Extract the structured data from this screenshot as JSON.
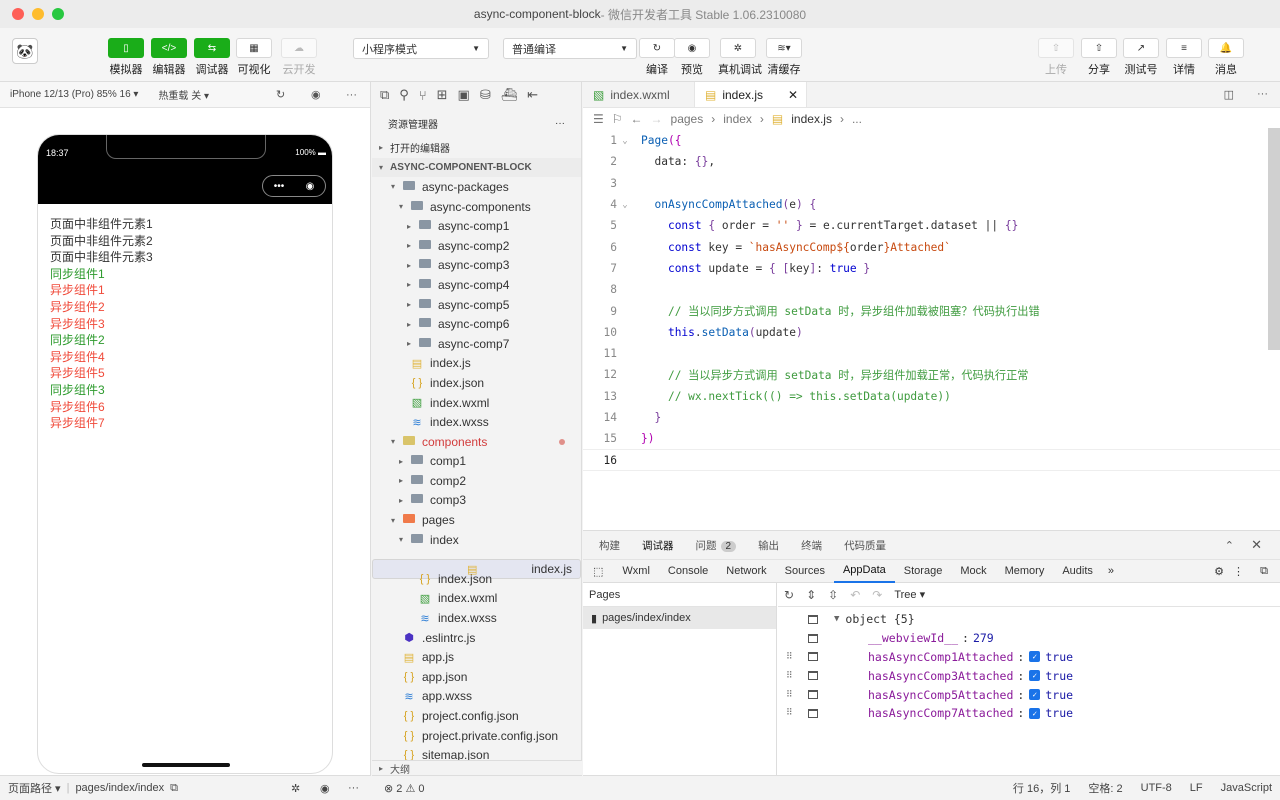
{
  "window": {
    "title": "async-component-block",
    "subtitle": " - 微信开发者工具 Stable 1.06.2310080",
    "lights": [
      "#fe5f57",
      "#febc2e",
      "#28c840"
    ]
  },
  "toolbar": {
    "simulator": "模拟器",
    "editor": "编辑器",
    "debugger": "调试器",
    "visual": "可视化",
    "cloud": "云开发",
    "mode_select": "小程序模式",
    "compile_select": "普通编译",
    "compile": "编译",
    "preview": "预览",
    "remote_debug": "真机调试",
    "clear_cache": "清缓存",
    "upload": "上传",
    "share": "分享",
    "test_account": "测试号",
    "details": "详情",
    "messages": "消息"
  },
  "simulator": {
    "device": "iPhone 12/13 (Pro) 85% 16 ▾",
    "hot_reload": "热重载 关 ▾",
    "time": "18:37",
    "battery": "100%",
    "items": [
      {
        "text": "页面中非组件元素1",
        "color": "#333333"
      },
      {
        "text": "页面中非组件元素2",
        "color": "#333333"
      },
      {
        "text": "页面中非组件元素3",
        "color": "#333333"
      },
      {
        "text": "同步组件1",
        "color": "#2e9b2e"
      },
      {
        "text": "异步组件1",
        "color": "#f04a3a"
      },
      {
        "text": "异步组件2",
        "color": "#f04a3a"
      },
      {
        "text": "异步组件3",
        "color": "#f04a3a"
      },
      {
        "text": "同步组件2",
        "color": "#2e9b2e"
      },
      {
        "text": "异步组件4",
        "color": "#f04a3a"
      },
      {
        "text": "异步组件5",
        "color": "#f04a3a"
      },
      {
        "text": "同步组件3",
        "color": "#2e9b2e"
      },
      {
        "text": "异步组件6",
        "color": "#f04a3a"
      },
      {
        "text": "异步组件7",
        "color": "#f04a3a"
      }
    ],
    "status_path_label": "页面路径 ▾",
    "status_path": "pages/index/index"
  },
  "explorer": {
    "header": "资源管理器",
    "open_editors": "打开的编辑器",
    "project": "ASYNC-COMPONENT-BLOCK",
    "tree": [
      {
        "indent": 16,
        "tw": "▾",
        "icon": "folder",
        "label": "async-packages"
      },
      {
        "indent": 24,
        "tw": "▾",
        "icon": "folder",
        "label": "async-components"
      },
      {
        "indent": 32,
        "tw": "▸",
        "icon": "folder",
        "label": "async-comp1"
      },
      {
        "indent": 32,
        "tw": "▸",
        "icon": "folder",
        "label": "async-comp2"
      },
      {
        "indent": 32,
        "tw": "▸",
        "icon": "folder",
        "label": "async-comp3"
      },
      {
        "indent": 32,
        "tw": "▸",
        "icon": "folder",
        "label": "async-comp4"
      },
      {
        "indent": 32,
        "tw": "▸",
        "icon": "folder",
        "label": "async-comp5"
      },
      {
        "indent": 32,
        "tw": "▸",
        "icon": "folder",
        "label": "async-comp6"
      },
      {
        "indent": 32,
        "tw": "▸",
        "icon": "folder",
        "label": "async-comp7"
      },
      {
        "indent": 24,
        "tw": "",
        "icon": "js",
        "label": "index.js"
      },
      {
        "indent": 24,
        "tw": "",
        "icon": "json",
        "label": "index.json"
      },
      {
        "indent": 24,
        "tw": "",
        "icon": "wxml",
        "label": "index.wxml"
      },
      {
        "indent": 24,
        "tw": "",
        "icon": "wxss",
        "label": "index.wxss"
      },
      {
        "indent": 16,
        "tw": "▾",
        "icon": "folder-y",
        "label": "components",
        "color": "#d23c3c",
        "dot": true
      },
      {
        "indent": 24,
        "tw": "▸",
        "icon": "folder",
        "label": "comp1"
      },
      {
        "indent": 24,
        "tw": "▸",
        "icon": "folder",
        "label": "comp2"
      },
      {
        "indent": 24,
        "tw": "▸",
        "icon": "folder",
        "label": "comp3"
      },
      {
        "indent": 16,
        "tw": "▾",
        "icon": "folder-r",
        "label": "pages"
      },
      {
        "indent": 24,
        "tw": "▾",
        "icon": "folder",
        "label": "index"
      },
      {
        "indent": 32,
        "tw": "",
        "icon": "js",
        "label": "index.js",
        "selected": true
      },
      {
        "indent": 32,
        "tw": "",
        "icon": "json",
        "label": "index.json"
      },
      {
        "indent": 32,
        "tw": "",
        "icon": "wxml",
        "label": "index.wxml"
      },
      {
        "indent": 32,
        "tw": "",
        "icon": "wxss",
        "label": "index.wxss"
      },
      {
        "indent": 16,
        "tw": "",
        "icon": "eslint",
        "label": ".eslintrc.js"
      },
      {
        "indent": 16,
        "tw": "",
        "icon": "js",
        "label": "app.js"
      },
      {
        "indent": 16,
        "tw": "",
        "icon": "json",
        "label": "app.json"
      },
      {
        "indent": 16,
        "tw": "",
        "icon": "wxss",
        "label": "app.wxss"
      },
      {
        "indent": 16,
        "tw": "",
        "icon": "json",
        "label": "project.config.json"
      },
      {
        "indent": 16,
        "tw": "",
        "icon": "json",
        "label": "project.private.config.json"
      },
      {
        "indent": 16,
        "tw": "",
        "icon": "json",
        "label": "sitemap.json"
      }
    ],
    "outline": "大纲",
    "problems": "⊗ 2 ⚠ 0"
  },
  "editor": {
    "tabs": [
      {
        "label": "index.wxml",
        "icon": "wxml",
        "active": false
      },
      {
        "label": "index.js",
        "icon": "js",
        "active": true
      }
    ],
    "breadcrumbs": [
      "pages",
      "index",
      "index.js",
      "..."
    ],
    "lines": [
      {
        "n": "1",
        "fold": "⌄",
        "html": "<span class='f'>Page</span><span class='b'>({</span>"
      },
      {
        "n": "2",
        "fold": "",
        "html": "  data: <span class='p'>{}</span>,"
      },
      {
        "n": "3",
        "fold": "",
        "html": ""
      },
      {
        "n": "4",
        "fold": "⌄",
        "html": "  <span class='f'>onAsyncCompAttached</span><span class='p'>(</span>e<span class='p'>)</span> <span class='p'>{</span>"
      },
      {
        "n": "5",
        "fold": "",
        "html": "    <span class='k'>const</span> <span class='p'>{</span> order = <span class='s'>''</span> <span class='p'>}</span> = e.currentTarget.dataset || <span class='p'>{}</span>"
      },
      {
        "n": "6",
        "fold": "",
        "html": "    <span class='k'>const</span> key = <span class='s'>`hasAsyncComp${</span>order<span class='s'>}Attached`</span>"
      },
      {
        "n": "7",
        "fold": "",
        "html": "    <span class='k'>const</span> update = <span class='p'>{</span> <span class='p'>[</span>key<span class='p'>]</span>: <span class='k'>true</span> <span class='p'>}</span>"
      },
      {
        "n": "8",
        "fold": "",
        "html": ""
      },
      {
        "n": "9",
        "fold": "",
        "html": "    <span class='c'>// 当以同步方式调用 setData 时，异步组件加载被阻塞？代码执行出错</span>"
      },
      {
        "n": "10",
        "fold": "",
        "html": "    <span class='k'>this</span>.<span class='f'>setData</span><span class='p'>(</span>update<span class='p'>)</span>"
      },
      {
        "n": "11",
        "fold": "",
        "html": ""
      },
      {
        "n": "12",
        "fold": "",
        "html": "    <span class='c'>// 当以异步方式调用 setData 时，异步组件加载正常，代码执行正常</span>"
      },
      {
        "n": "13",
        "fold": "",
        "html": "    <span class='c'>// wx.nextTick(() =&gt; this.setData(update))</span>"
      },
      {
        "n": "14",
        "fold": "",
        "html": "  <span class='p'>}</span>"
      },
      {
        "n": "15",
        "fold": "",
        "html": "<span class='b'>})</span>"
      },
      {
        "n": "16",
        "fold": "",
        "html": "",
        "current": true
      }
    ]
  },
  "devtools": {
    "panel_tabs": [
      "构建",
      "调试器",
      "问题",
      "输出",
      "终端",
      "代码质量"
    ],
    "problems_count": "2",
    "tabs": [
      "Wxml",
      "Console",
      "Network",
      "Sources",
      "AppData",
      "Storage",
      "Mock",
      "Memory",
      "Audits"
    ],
    "active_tab": "AppData",
    "pages_header": "Pages",
    "page_item": "pages/index/index",
    "view_mode": "Tree",
    "root": "object {5}",
    "webview_key": "__webviewId__",
    "webview_value": "279",
    "props": [
      {
        "key": "hasAsyncComp1Attached",
        "value": "true"
      },
      {
        "key": "hasAsyncComp3Attached",
        "value": "true"
      },
      {
        "key": "hasAsyncComp5Attached",
        "value": "true"
      },
      {
        "key": "hasAsyncComp7Attached",
        "value": "true"
      }
    ]
  },
  "status": {
    "position": "行 16，列 1",
    "spaces": "空格: 2",
    "encoding": "UTF-8",
    "eol": "LF",
    "language": "JavaScript"
  }
}
